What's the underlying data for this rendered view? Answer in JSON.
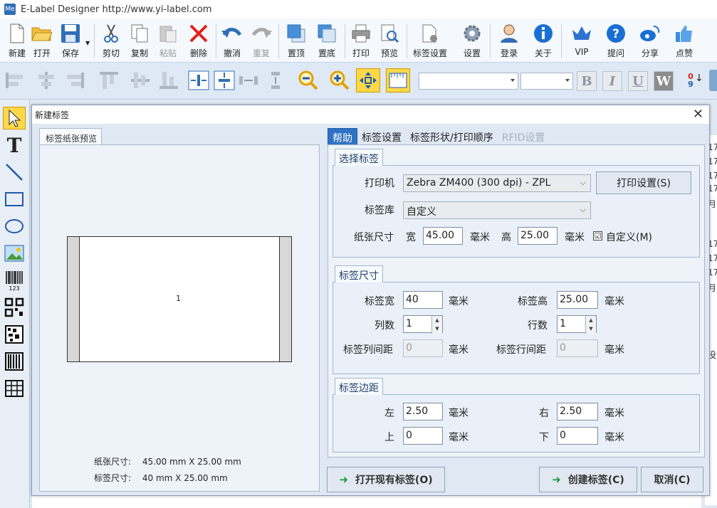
{
  "app": {
    "title": "E-Label Designer http://www.yi-label.com",
    "icon_text": "Me"
  },
  "ribbon": {
    "new": "新建",
    "open": "打开",
    "save": "保存",
    "cut": "剪切",
    "copy": "复制",
    "paste": "粘贴",
    "delete": "删除",
    "undo": "撤消",
    "redo": "重复",
    "bring_top": "置顶",
    "send_bottom": "置底",
    "print": "打印",
    "preview": "预览",
    "label_settings": "标签设置",
    "settings": "设置",
    "login": "登录",
    "about": "关于",
    "vip": "VIP",
    "question": "提问",
    "share": "分享",
    "like": "点赞"
  },
  "format": {
    "bold": "B",
    "italic": "I",
    "underline": "U",
    "wordwrap": "W",
    "sort_top": "0",
    "sort_bottom": "9"
  },
  "background": {
    "right_texts": [
      "17",
      "17",
      "17",
      "17",
      "月",
      "17",
      "17",
      "17",
      "月",
      "没"
    ]
  },
  "dialog": {
    "title": "新建标签",
    "close": "✕",
    "preview": {
      "tab": "标签纸张预览",
      "label_number": "1",
      "paper_size_label": "纸张尺寸:",
      "paper_size_value": "45.00 mm X 25.00 mm",
      "label_size_label": "标签尺寸:",
      "label_size_value": "40 mm X 25.00 mm"
    },
    "tabs": {
      "help": "帮助",
      "label_settings": "标签设置",
      "shape_order": "标签形状/打印顺序",
      "rfid": "RFID设置"
    },
    "select_label": {
      "title": "选择标签",
      "printer_label": "打印机",
      "printer_value": "Zebra ZM400 (300 dpi) - ZPL",
      "print_settings": "打印设置(S)",
      "library_label": "标签库",
      "library_value": "自定义",
      "paper_size_label": "纸张尺寸",
      "width_label": "宽",
      "width_value": "45.00",
      "unit": "毫米",
      "height_label": "高",
      "height_value": "25.00",
      "custom_label": "自定义(M)",
      "custom_check": "☑"
    },
    "label_size": {
      "title": "标签尺寸",
      "width_label": "标签宽",
      "width_value": "40",
      "height_label": "标签高",
      "height_value": "25.00",
      "cols_label": "列数",
      "cols_value": "1",
      "rows_label": "行数",
      "rows_value": "1",
      "col_gap_label": "标签列间距",
      "col_gap_value": "0",
      "row_gap_label": "标签行间距",
      "row_gap_value": "0",
      "unit": "毫米"
    },
    "margins": {
      "title": "标签边距",
      "left_label": "左",
      "left_value": "2.50",
      "right_label": "右",
      "right_value": "2.50",
      "top_label": "上",
      "top_value": "0",
      "bottom_label": "下",
      "bottom_value": "0",
      "unit": "毫米"
    },
    "buttons": {
      "open_existing": "打开现有标签(O)",
      "create": "创建标签(C)",
      "cancel": "取消(C)"
    }
  }
}
